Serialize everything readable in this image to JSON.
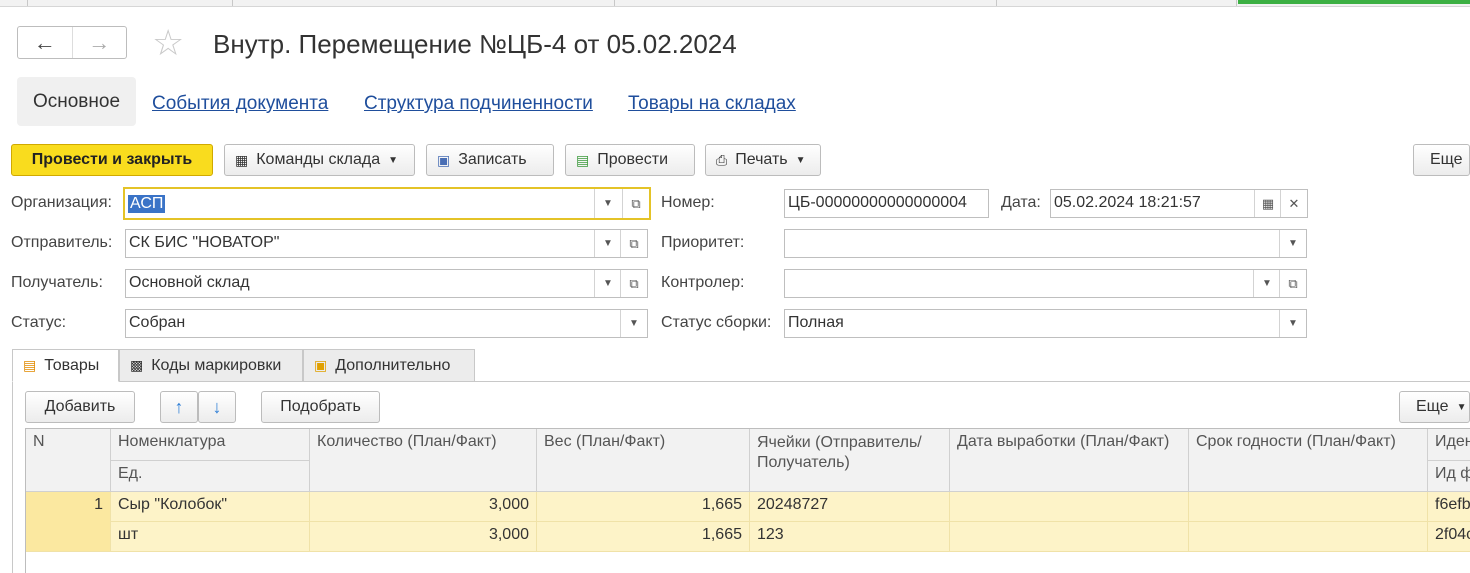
{
  "window": {
    "title": "Внутр. Перемещение №ЦБ-4 от 05.02.2024",
    "back_icon": "arrow-left-icon",
    "forward_icon": "arrow-right-icon",
    "favorite_icon": "star-icon"
  },
  "nav_tabs": {
    "main": "Основное",
    "events": "События документа",
    "structure": "Структура подчиненности",
    "stock": "Товары на складах"
  },
  "toolbar": {
    "post_close": "Провести и закрыть",
    "warehouse_commands": "Команды склада",
    "save": "Записать",
    "post": "Провести",
    "print": "Печать",
    "more": "Еще"
  },
  "form": {
    "organization_label": "Организация:",
    "organization_value": "АСП",
    "sender_label": "Отправитель:",
    "sender_value": "СК БИС \"НОВАТОР\"",
    "receiver_label": "Получатель:",
    "receiver_value": "Основной склад",
    "status_label": "Статус:",
    "status_value": "Собран",
    "number_label": "Номер:",
    "number_value": "ЦБ-00000000000000004",
    "date_label": "Дата:",
    "date_value": "05.02.2024 18:21:57",
    "priority_label": "Приоритет:",
    "priority_value": "",
    "controller_label": "Контролер:",
    "controller_value": "",
    "assembly_status_label": "Статус сборки:",
    "assembly_status_value": "Полная"
  },
  "subtabs": {
    "goods": "Товары",
    "marking": "Коды маркировки",
    "extra": "Дополнительно"
  },
  "table_toolbar": {
    "add": "Добавить",
    "pick": "Подобрать",
    "more": "Еще"
  },
  "table": {
    "headers": {
      "n": "N",
      "nomenclature": "Номенклатура",
      "unit": "Ед.",
      "qty": "Количество (План/Факт)",
      "weight": "Вес (План/Факт)",
      "cells_1": "Ячейки (Отправитель/",
      "cells_2": "Получатель)",
      "production_date": "Дата выработки (План/Факт)",
      "expiry": "Срок годности (План/Факт)",
      "ident_1": "Иден",
      "ident_2": "Ид ф"
    },
    "rows": [
      {
        "n": "1",
        "nomenclature": "Сыр \"Колобок\"",
        "unit": "шт",
        "qty_plan": "3,000",
        "qty_fact": "3,000",
        "weight_plan": "1,665",
        "weight_fact": "1,665",
        "cell_sender": "20248727",
        "cell_receiver": "123",
        "ident_1": "f6efb",
        "ident_2": "2f04c"
      }
    ]
  }
}
